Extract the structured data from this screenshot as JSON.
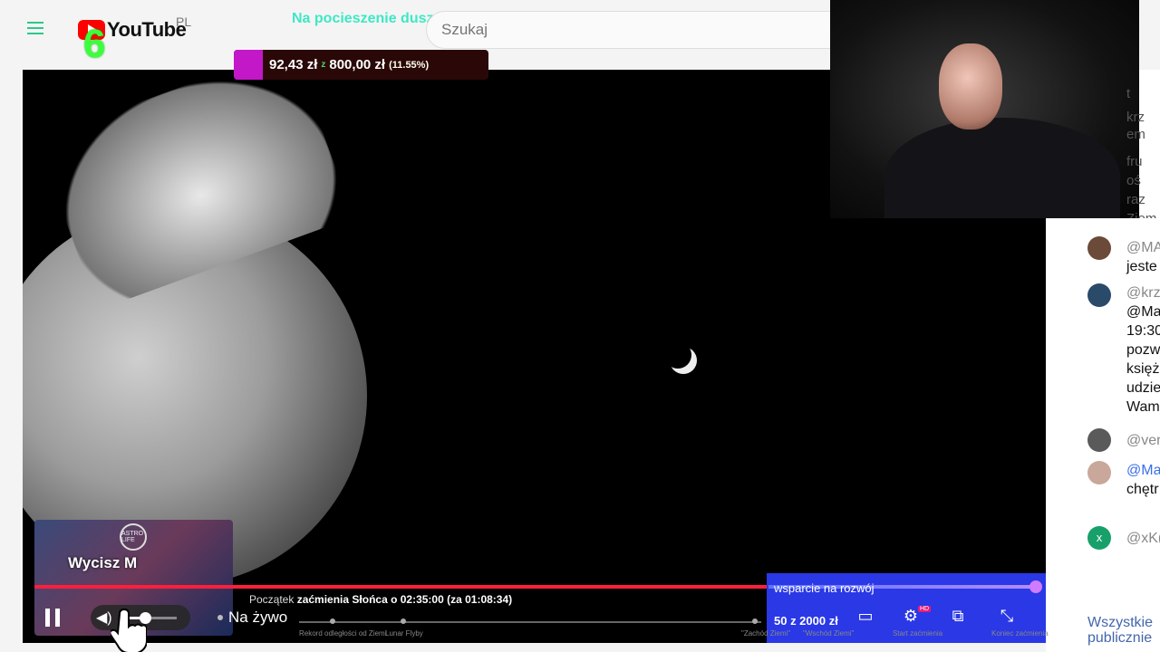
{
  "header": {
    "logo_text": "YouTube",
    "region": "PL",
    "overlay_title": "Na pocieszenie duszy",
    "search_placeholder": "Szukaj",
    "overlay_number": "6"
  },
  "goal": {
    "current": "92,43 zł",
    "target": "800,00 zł",
    "percent": "(11.55%)",
    "progress_fraction": 0.1155
  },
  "chat": {
    "top_fragments": [
      "t",
      "krz",
      "em",
      "fru",
      "oś",
      "raz",
      "Ziem"
    ],
    "messages": [
      {
        "author": "@MA",
        "text": "jeste",
        "avatar_color": "#6b4a3a"
      },
      {
        "author": "@krz",
        "text": "@Ma",
        "lines": [
          "19:30",
          "pozw",
          "księż",
          "udzie",
          "Wam"
        ],
        "avatar_color": "#2a4a6a"
      },
      {
        "author": "@ver",
        "text": "",
        "avatar_color": "#5a5a5a"
      },
      {
        "author": "@Ma",
        "text": "chętr",
        "avatar_color": "#c9a79a"
      },
      {
        "author": "@xK(",
        "text": "",
        "avatar_color": "#17a06a",
        "avatar_letter": "x"
      }
    ],
    "footer_text": "Wszystkie\npublicznie"
  },
  "mini_player": {
    "label": "Wycisz  M",
    "badge": "ASTRO LIFE"
  },
  "player": {
    "chapter_prefix": "Początek",
    "chapter_text": "zaćmienia Słońca o 02:35:00 (za 01:08:34)",
    "live_label": "Na żywo",
    "volume_fraction": 0.35,
    "chapters": [
      {
        "label": "Rekord odległości od Ziemi"
      },
      {
        "label": "Lunar Flyby"
      },
      {
        "label": "\"Zachód Ziemi\""
      },
      {
        "label": "\"Wschód Ziemi\""
      },
      {
        "label": "Start zaćmienia"
      },
      {
        "label": "Koniec zaćmienia"
      }
    ]
  },
  "support": {
    "label": "wsparcie na rozwój",
    "amount": "50  z  2000  zł",
    "hd_badge": "HD"
  },
  "colors": {
    "progress": "#ff1e3c",
    "support_bg": "#2a38e6",
    "overlay_green": "#3ee8c4",
    "goal_fill": "#c318c8"
  }
}
